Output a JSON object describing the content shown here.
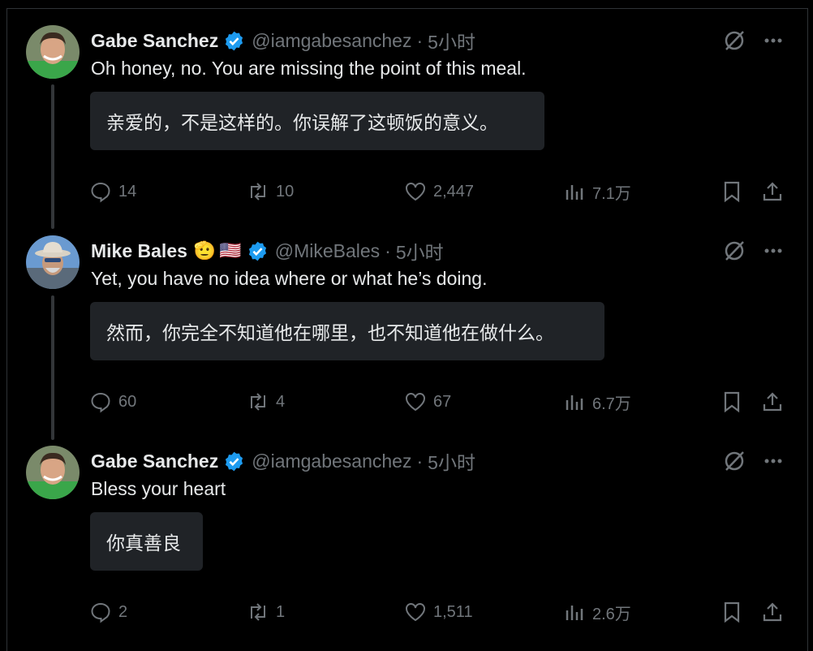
{
  "tweets": [
    {
      "name": "Gabe Sanchez",
      "handle": "@iamgabesanchez",
      "time": "5小时",
      "text": "Oh honey, no. You are missing the point of this meal.",
      "translation": "亲爱的，不是这样的。你误解了这顿饭的意义。",
      "replies": "14",
      "reposts": "10",
      "likes": "2,447",
      "views": "7.1万"
    },
    {
      "name": "Mike Bales",
      "handle": "@MikeBales",
      "time": "5小时",
      "emoji": [
        "🫡",
        "🇺🇸"
      ],
      "text": "Yet, you have no idea where or what he’s doing.",
      "translation": "然而，你完全不知道他在哪里，也不知道他在做什么。",
      "replies": "60",
      "reposts": "4",
      "likes": "67",
      "views": "6.7万"
    },
    {
      "name": "Gabe Sanchez",
      "handle": "@iamgabesanchez",
      "time": "5小时",
      "text": "Bless your heart",
      "translation": "你真善良",
      "replies": "2",
      "reposts": "1",
      "likes": "1,511",
      "views": "2.6万"
    }
  ],
  "separator": "·",
  "colors": {
    "background": "#000000",
    "text": "#e7e9ea",
    "muted": "#71767b",
    "verified": "#1d9bf0",
    "translation_bg": "#202327"
  }
}
